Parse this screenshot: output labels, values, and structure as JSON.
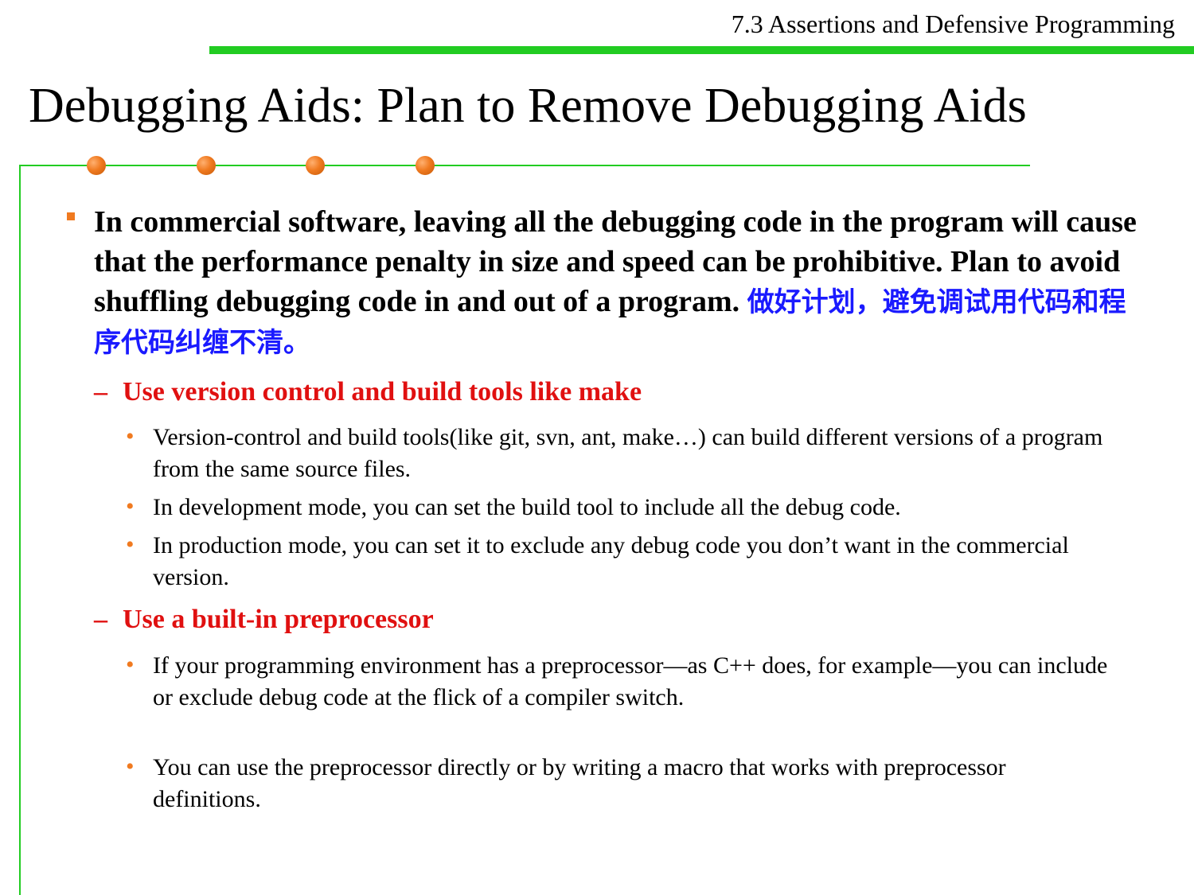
{
  "header": {
    "section": "7.3 Assertions and Defensive Programming"
  },
  "title": "Debugging Aids: Plan to Remove Debugging Aids",
  "bullets": {
    "main": {
      "text_en": "In commercial software, leaving all the debugging code in the program will cause that  the performance penalty in size and speed can be prohibitive. Plan to avoid shuffling debugging code in and out of a program.",
      "text_cn": "做好计划，避免调试用代码和程序代码纠缠不清。"
    },
    "sub1": {
      "marker": "–",
      "label": "Use version control and build tools like make",
      "items": [
        "Version-control and build tools(like git, svn, ant, make…) can build different versions of a program from the same source files.",
        "In development mode, you can set the build tool to include all the debug code.",
        "In production mode, you can set it to exclude any debug code you don’t want in the commercial version."
      ]
    },
    "sub2": {
      "marker": "–",
      "label": "Use a built-in preprocessor",
      "items": [
        "If your programming environment has a preprocessor—as C++ does, for example—you can include or exclude debug code at the flick of a compiler switch.",
        "You can use the preprocessor directly or by writing a macro that works with preprocessor definitions."
      ]
    }
  },
  "colors": {
    "accent_green": "#22cc22",
    "bullet_orange": "#f07a20",
    "heading_red": "#e01010",
    "chinese_blue": "#1a1aff"
  },
  "markers": {
    "sub_bullet": "•"
  }
}
